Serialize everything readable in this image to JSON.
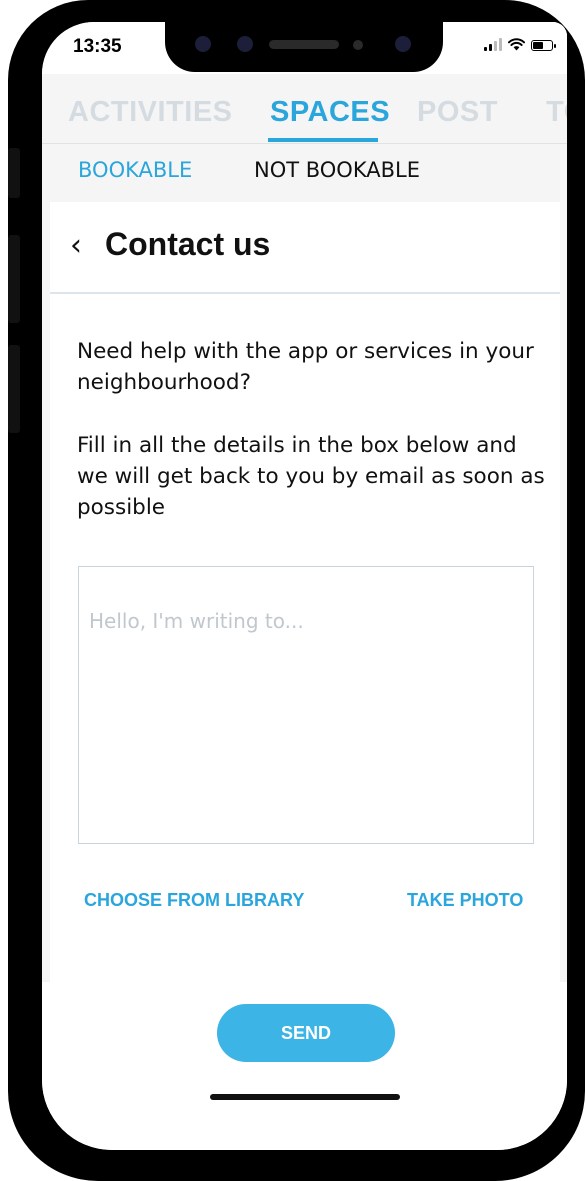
{
  "status_bar": {
    "time": "13:35",
    "icons": [
      "signal-icon",
      "wifi-icon",
      "battery-icon"
    ]
  },
  "tabs": [
    {
      "label": "ACTIVITIES",
      "active": false
    },
    {
      "label": "SPACES",
      "active": true
    },
    {
      "label": "POST",
      "active": false
    },
    {
      "label": "TO",
      "active": false
    }
  ],
  "subtabs": [
    {
      "label": "BOOKABLE",
      "active": true
    },
    {
      "label": "NOT BOOKABLE",
      "active": false
    }
  ],
  "header": {
    "back_icon": "chevron-left-icon",
    "title": "Contact us"
  },
  "content": {
    "intro": "Need help with the app or services in your neighbourhood?",
    "instructions": "Fill in all the details in the box below and we will get back to you by email as soon as possible",
    "message_placeholder": "Hello, I'm writing to...",
    "message_value": ""
  },
  "actions": {
    "choose_library": "CHOOSE FROM LIBRARY",
    "take_photo": "TAKE PHOTO",
    "send": "SEND"
  },
  "colors": {
    "accent": "#2aa6dc",
    "send_button": "#3cb4e5",
    "inactive_tab": "#d4dce2",
    "background": "#f5f5f5"
  }
}
